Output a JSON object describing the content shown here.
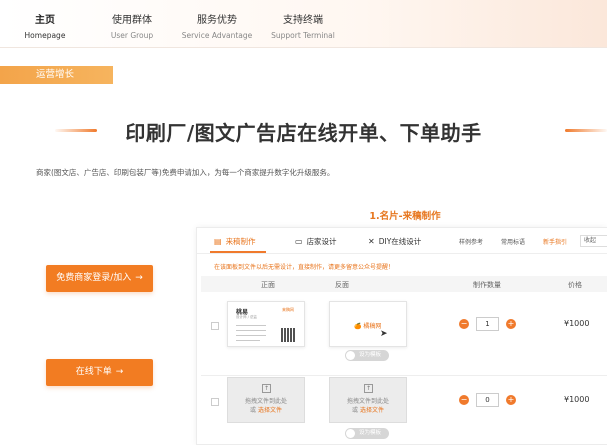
{
  "nav": {
    "items": [
      {
        "cn": "主页",
        "en": "Homepage"
      },
      {
        "cn": "使用群体",
        "en": "User Group"
      },
      {
        "cn": "服务优势",
        "en": "Service Advantage"
      },
      {
        "cn": "支持终端",
        "en": "Support Terminal"
      }
    ],
    "active_index": 0
  },
  "section_tag": "运营增长",
  "hero_title": "印刷厂/图文广告店在线开单、下单助手",
  "intro": "商家(图文店、广告店、印刷包装厂等)免费申请加入，为每一个商家提升数字化升级服务。",
  "sub_title": "1.名片-来稿制作",
  "buttons": {
    "register": "免费商家登录/加入",
    "order": "在线下单",
    "arrow": "→"
  },
  "panel": {
    "tabs": [
      {
        "label": "来稿制作",
        "icon": "document-icon"
      },
      {
        "label": "店家设计",
        "icon": "monitor-icon"
      },
      {
        "label": "DIY在线设计",
        "icon": "tools-icon"
      }
    ],
    "links": {
      "sample": "样例参考",
      "terms": "常用标语",
      "guide": "新手指引",
      "sort": "收起"
    },
    "notice": "在该面板到文件以后无需设计，直接制作，请更多留意公众号提醒！",
    "headers": {
      "front": "正面",
      "back": "反面",
      "qty": "制作数量",
      "price": "价格"
    },
    "row1": {
      "card_name": "桃易",
      "card_role": "设计师 / 总监",
      "card_logo": "来稿网",
      "back_logo": "🍊 橘稿网",
      "qty": "1",
      "price": "¥1000",
      "toggle": "设为模板"
    },
    "row2": {
      "drop_line1": "拖拽文件到此处",
      "drop_prefix": "或 ",
      "drop_pick": "选择文件",
      "qty": "0",
      "price": "¥1000",
      "toggle": "设为模板"
    },
    "minus": "−",
    "plus": "+"
  },
  "colors": {
    "accent": "#f27c22",
    "tag": "#f3a44a",
    "title_orange": "#e7771f"
  }
}
